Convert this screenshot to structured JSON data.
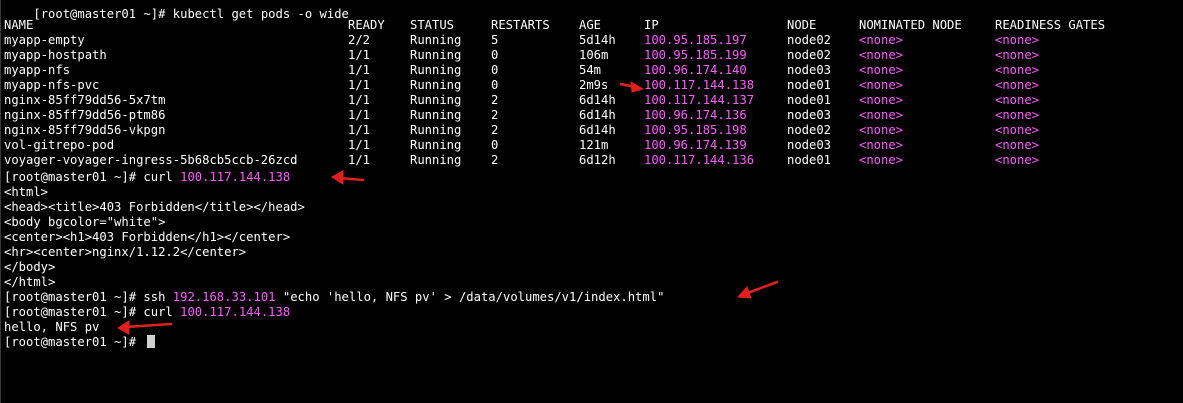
{
  "prompt": "[root@master01 ~]# ",
  "lines": {
    "top_partial": "[root@master01 ~]# kubectl get pods -o wide",
    "curl_forbidden_cmd": "curl",
    "curl_forbidden_ip": "100.117.144.138",
    "ssh_cmd": "ssh",
    "ssh_ip": "192.168.33.101",
    "ssh_args": "\"echo 'hello, NFS pv' > /data/volumes/v1/index.html\"",
    "curl_ok_cmd": "curl",
    "curl_ok_ip": "100.117.144.138",
    "hello_output": "hello, NFS pv"
  },
  "html_output": [
    "<html>",
    "<head><title>403 Forbidden</title></head>",
    "<body bgcolor=\"white\">",
    "<center><h1>403 Forbidden</h1></center>",
    "<hr><center>nginx/1.12.2</center>",
    "</body>",
    "</html>"
  ],
  "pods_table": {
    "headers": [
      "NAME",
      "READY",
      "STATUS",
      "RESTARTS",
      "AGE",
      "IP",
      "NODE",
      "NOMINATED NODE",
      "READINESS GATES"
    ],
    "rows": [
      [
        "myapp-empty",
        "2/2",
        "Running",
        "5",
        "5d14h",
        "100.95.185.197",
        "node02",
        "<none>",
        "<none>"
      ],
      [
        "myapp-hostpath",
        "1/1",
        "Running",
        "0",
        "106m",
        "100.95.185.199",
        "node02",
        "<none>",
        "<none>"
      ],
      [
        "myapp-nfs",
        "1/1",
        "Running",
        "0",
        "54m",
        "100.96.174.140",
        "node03",
        "<none>",
        "<none>"
      ],
      [
        "myapp-nfs-pvc",
        "1/1",
        "Running",
        "0",
        "2m9s",
        "100.117.144.138",
        "node01",
        "<none>",
        "<none>"
      ],
      [
        "nginx-85ff79dd56-5x7tm",
        "1/1",
        "Running",
        "2",
        "6d14h",
        "100.117.144.137",
        "node01",
        "<none>",
        "<none>"
      ],
      [
        "nginx-85ff79dd56-ptm86",
        "1/1",
        "Running",
        "2",
        "6d14h",
        "100.96.174.136",
        "node03",
        "<none>",
        "<none>"
      ],
      [
        "nginx-85ff79dd56-vkpgn",
        "1/1",
        "Running",
        "2",
        "6d14h",
        "100.95.185.198",
        "node02",
        "<none>",
        "<none>"
      ],
      [
        "vol-gitrepo-pod",
        "1/1",
        "Running",
        "0",
        "121m",
        "100.96.174.139",
        "node03",
        "<none>",
        "<none>"
      ],
      [
        "voyager-voyager-ingress-5b68cb5ccb-26zcd",
        "1/1",
        "Running",
        "2",
        "6d12h",
        "100.117.144.136",
        "node01",
        "<none>",
        "<none>"
      ]
    ]
  },
  "colors": {
    "background": "#000000",
    "text": "#ffffff",
    "highlight": "#ff5cff",
    "annotation_arrow": "#e02020"
  }
}
